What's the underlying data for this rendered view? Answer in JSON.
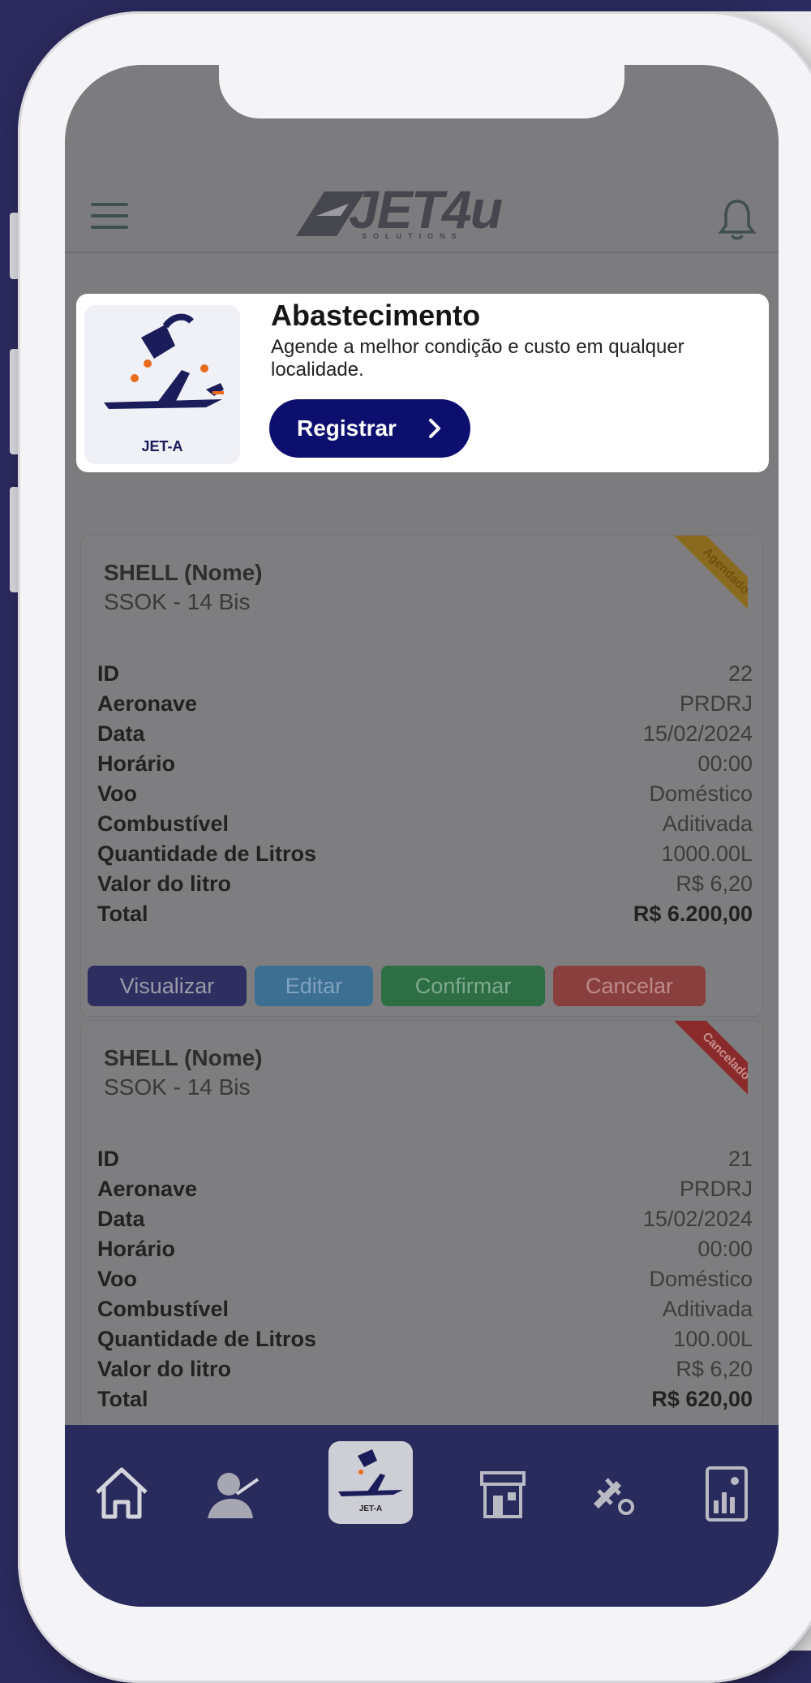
{
  "header": {
    "logo_text": "JET4u",
    "logo_subtext": "SOLUTIONS"
  },
  "promo": {
    "title": "Abastecimento",
    "description": "Agende a melhor condição e custo em qualquer localidade.",
    "button_label": "Registrar",
    "image_label": "JET-A"
  },
  "row_labels": {
    "id": "ID",
    "aircraft": "Aeronave",
    "date": "Data",
    "time": "Horário",
    "flight": "Voo",
    "fuel": "Combustível",
    "liters": "Quantidade de Litros",
    "price": "Valor do litro",
    "total": "Total"
  },
  "orders": [
    {
      "supplier": "SHELL (Nome)",
      "location": "SSOK - 14 Bis",
      "status": "Agendado",
      "status_color": "#8a6a1e",
      "id": "22",
      "aircraft": "PRDRJ",
      "date": "15/02/2024",
      "time": "00:00",
      "flight": "Doméstico",
      "fuel": "Aditivada",
      "liters": "1000.00L",
      "price": "R$ 6,20",
      "total": "R$ 6.200,00"
    },
    {
      "supplier": "SHELL (Nome)",
      "location": "SSOK - 14 Bis",
      "status": "Cancelado",
      "status_color": "#8a2a2a",
      "id": "21",
      "aircraft": "PRDRJ",
      "date": "15/02/2024",
      "time": "00:00",
      "flight": "Doméstico",
      "fuel": "Aditivada",
      "liters": "100.00L",
      "price": "R$ 6,20",
      "total": "R$ 620,00"
    }
  ],
  "actions": {
    "view": "Visualizar",
    "edit": "Editar",
    "confirm": "Confirmar",
    "cancel": "Cancelar"
  },
  "colors": {
    "primary": "#0d0f6f",
    "tabbar": "#2a2b5d",
    "view_btn": "#2e2f60",
    "edit_btn": "#3d6f92",
    "confirm_btn": "#2d6e45",
    "cancel_btn": "#8a3f3f"
  },
  "tabbar": {
    "center_label": "JET-A",
    "icons": [
      "home-icon",
      "pilot-icon",
      "fuel-icon",
      "store-icon",
      "airplane-discount-icon",
      "report-icon"
    ]
  }
}
